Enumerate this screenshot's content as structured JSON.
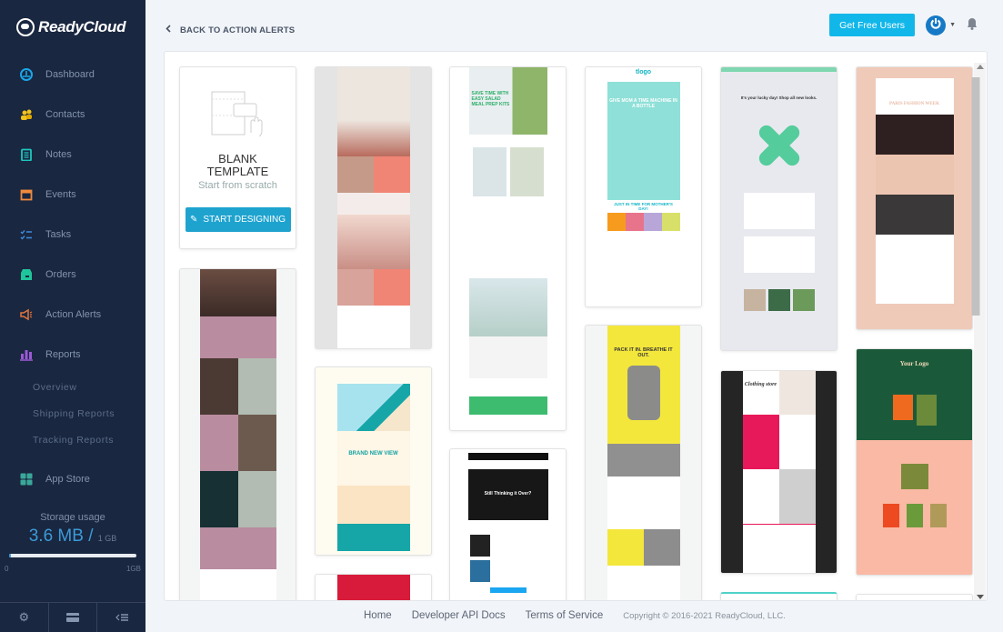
{
  "sidebar": {
    "brand": "ReadyCloud",
    "items": [
      {
        "label": "Dashboard",
        "icon": "dashboard-icon",
        "color": "#1aa7e8"
      },
      {
        "label": "Contacts",
        "icon": "contacts-icon",
        "color": "#f2c21b"
      },
      {
        "label": "Notes",
        "icon": "notes-icon",
        "color": "#1cc6c0"
      },
      {
        "label": "Events",
        "icon": "events-icon",
        "color": "#f08a3c"
      },
      {
        "label": "Tasks",
        "icon": "tasks-icon",
        "color": "#3d8be0"
      },
      {
        "label": "Orders",
        "icon": "orders-icon",
        "color": "#1fc59b"
      },
      {
        "label": "Action Alerts",
        "icon": "megaphone-icon",
        "color": "#e2763a"
      },
      {
        "label": "Reports",
        "icon": "reports-icon",
        "color": "#9b5ad6"
      }
    ],
    "report_subitems": [
      "Overview",
      "Shipping Reports",
      "Tracking Reports"
    ],
    "app_store": {
      "label": "App Store",
      "icon": "app-store-icon",
      "color": "#3aa79a"
    },
    "storage": {
      "label": "Storage usage",
      "used": "3.6 MB",
      "separator": "/",
      "total": "1 GB",
      "used_fraction": 0.0035,
      "scale_min": "0",
      "scale_max": "1GB"
    },
    "footer_icons": [
      "settings-icon",
      "billing-icon",
      "collapse-sidebar-icon"
    ]
  },
  "header": {
    "back_label": "BACK TO ACTION ALERTS",
    "get_free_users": "Get Free Users"
  },
  "blank_template": {
    "title_line1": "BLANK",
    "title_line2": "TEMPLATE",
    "subtitle": "Start from scratch",
    "button": "START DESIGNING"
  },
  "templates": [
    {
      "name": "summer-hats-template",
      "bg": "#e4e4e4"
    },
    {
      "name": "salad-meal-prep-template",
      "bg": "#ffffff",
      "headline": "SAVE TIME WITH EASY SALAD MEAL PREP KITS"
    },
    {
      "name": "mothers-day-serum-template",
      "bg": "#ffffff",
      "headline": "GIVE MOM A TIME MACHINE IN A BOTTLE",
      "subheadline": "JUST IN TIME FOR MOTHER'S DAY!"
    },
    {
      "name": "lucky-day-template",
      "bg": "#e8e9ef",
      "headline": "It's your lucky day! Shop all new looks."
    },
    {
      "name": "paris-fashion-week-template",
      "bg": "#efcab8",
      "headline": "PARIS FASHION WEEK"
    },
    {
      "name": "yoga-template",
      "bg": "#f4f5f5"
    },
    {
      "name": "eyewear-template",
      "bg": "#fefcf0",
      "headline": "BRAND NEW VIEW"
    },
    {
      "name": "abandoned-cart-template",
      "bg": "#ffffff",
      "headline": "Still Thinking it Over?"
    },
    {
      "name": "backpack-template",
      "bg": "#f4f5f5",
      "headline": "PACK IT IN. BREATHE IT OUT."
    },
    {
      "name": "clothing-store-template",
      "bg": "#252525",
      "headline": "Clothing store"
    },
    {
      "name": "soap-template",
      "bg": "#f9b9a4",
      "headline": "Your Logo"
    }
  ],
  "footer": {
    "links": [
      "Home",
      "Developer API Docs",
      "Terms of Service"
    ],
    "copyright": "Copyright © 2016-2021 ReadyCloud, LLC."
  }
}
